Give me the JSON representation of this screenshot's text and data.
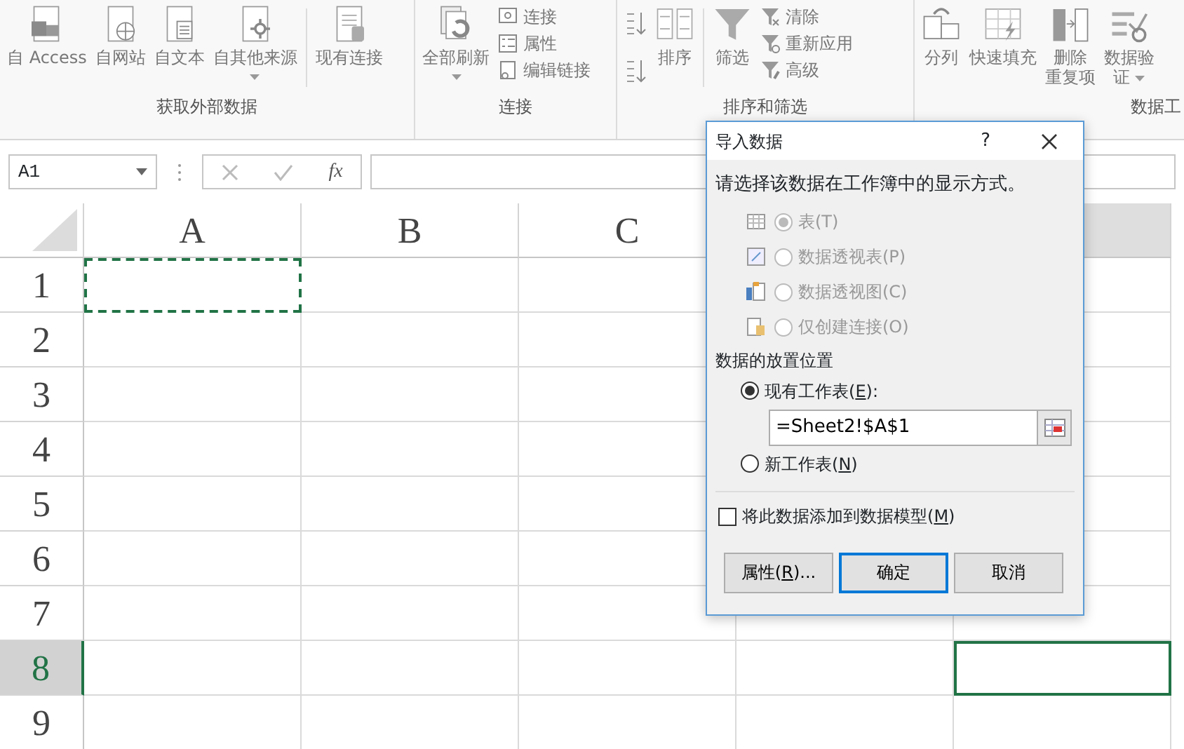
{
  "ribbon": {
    "groups": [
      {
        "label": "获取外部数据",
        "items": [
          {
            "kind": "large",
            "label_lines": [
              "自 Access"
            ],
            "dropdown": false
          },
          {
            "kind": "large",
            "label_lines": [
              "自网站"
            ],
            "dropdown": false
          },
          {
            "kind": "large",
            "label_lines": [
              "自文本"
            ],
            "dropdown": false
          },
          {
            "kind": "large",
            "label_lines": [
              "自其他来源"
            ],
            "dropdown": true
          },
          {
            "kind": "separator"
          },
          {
            "kind": "large",
            "label_lines": [
              "现有连接"
            ],
            "dropdown": false
          }
        ]
      },
      {
        "label": "连接",
        "items": [
          {
            "kind": "large",
            "label_lines": [
              "全部刷新"
            ],
            "dropdown": true
          },
          {
            "kind": "smalls",
            "entries": [
              "连接",
              "属性",
              "编辑链接"
            ]
          }
        ]
      },
      {
        "label": "排序和筛选",
        "items": [
          {
            "kind": "sorticons"
          },
          {
            "kind": "large",
            "label_lines": [
              "排序"
            ],
            "dropdown": false
          },
          {
            "kind": "separator"
          },
          {
            "kind": "large",
            "label_lines": [
              "筛选"
            ],
            "dropdown": false
          },
          {
            "kind": "smalls",
            "entries": [
              "清除",
              "重新应用",
              "高级"
            ]
          }
        ]
      },
      {
        "label": "数据工",
        "items": [
          {
            "kind": "large",
            "label_lines": [
              "分列"
            ],
            "dropdown": false
          },
          {
            "kind": "large",
            "label_lines": [
              "快速填充"
            ],
            "dropdown": false
          },
          {
            "kind": "large",
            "label_lines": [
              "删除",
              "重复项"
            ],
            "dropdown": false
          },
          {
            "kind": "large",
            "label_lines": [
              "数据验",
              "证"
            ],
            "dropdown": true
          }
        ]
      }
    ]
  },
  "formula_bar": {
    "name_box": "A1",
    "fx": "fx"
  },
  "sheet": {
    "columns": [
      {
        "label": "A",
        "selected": false,
        "marquee": true
      },
      {
        "label": "B",
        "selected": false,
        "marquee": false
      },
      {
        "label": "C",
        "selected": false,
        "marquee": false
      },
      {},
      {
        "selected": true,
        "marquee": false
      }
    ],
    "rows": [
      {
        "label": "1",
        "selected": false,
        "marquee": true
      },
      {
        "label": "2",
        "selected": false,
        "marquee": false
      },
      {
        "label": "3",
        "selected": false,
        "marquee": false
      },
      {
        "label": "4",
        "selected": false,
        "marquee": false
      },
      {
        "label": "5",
        "selected": false,
        "marquee": false
      },
      {
        "label": "6",
        "selected": false,
        "marquee": false
      },
      {
        "label": "7",
        "selected": false,
        "marquee": false
      },
      {
        "label": "8",
        "selected": true,
        "marquee": false
      },
      {
        "label": "9",
        "selected": false,
        "marquee": false
      }
    ]
  },
  "dialog": {
    "title": "导入数据",
    "help": "?",
    "display_prompt": "请选择该数据在工作簿中的显示方式。",
    "display_options": [
      {
        "label": "表(T)",
        "selected": true,
        "disabled": true
      },
      {
        "label": "数据透视表(P)",
        "selected": false,
        "disabled": true
      },
      {
        "label": "数据透视图(C)",
        "selected": false,
        "disabled": true
      },
      {
        "label": "仅创建连接(O)",
        "selected": false,
        "disabled": true
      }
    ],
    "placement_heading": "数据的放置位置",
    "placement_options": [
      {
        "label_parts": [
          "现有工作表(",
          "E",
          "):"
        ],
        "selected": true
      },
      {
        "label_parts": [
          "新工作表(",
          "N",
          ")"
        ],
        "selected": false
      }
    ],
    "location": "=Sheet2!$A$1",
    "add_to_model": {
      "label_parts": [
        "将此数据添加到数据模型(",
        "M",
        ")"
      ],
      "checked": false
    },
    "buttons": [
      {
        "label_parts": [
          "属性(",
          "R",
          ")..."
        ],
        "default": false
      },
      {
        "label_parts": [
          "确定"
        ],
        "default": true
      },
      {
        "label_parts": [
          "取消"
        ],
        "default": false
      }
    ]
  }
}
